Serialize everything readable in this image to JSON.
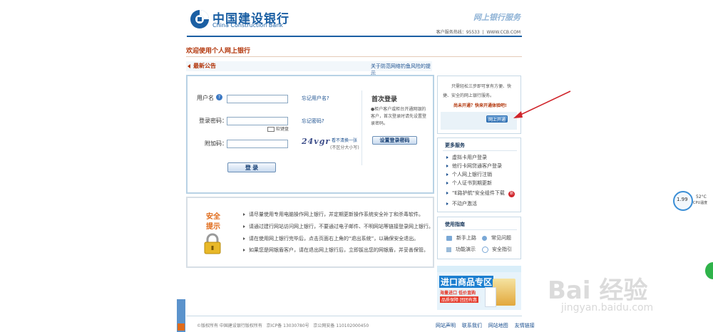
{
  "header": {
    "logo_cn": "中国建设银行",
    "logo_en": "China Construction Bank",
    "service_title": "网上银行服务",
    "hotline": "客户服务热线：95533",
    "url": "WWW.CCB.COM"
  },
  "welcome": "欢迎使用个人网上银行",
  "notice": {
    "label": "最新公告",
    "link": "关于防范网络钓鱼风险的提示"
  },
  "login": {
    "username_label": "用户名",
    "forgot_username": "忘记用户名?",
    "password_label": "登录密码：",
    "forgot_password": "忘记密码?",
    "soft_keyboard": "软键盘",
    "captcha_label": "附加码：",
    "captcha_text": "24vgr",
    "captcha_refresh": "看不清换一张",
    "captcha_hint": "(不区分大小写)",
    "submit": "登 录"
  },
  "first_login": {
    "title": "首次登录",
    "desc": "●柜户客户或柜台开通网银的客户，首次登录时请先设置登录密码。",
    "button": "设置登录密码"
  },
  "promo": {
    "text": "只需轻松三步即可享有方便、快捷、安全的网上银行服务。",
    "question": "尚未开通？快来开通体验吧!",
    "button": "网上开通"
  },
  "more_services": {
    "title": "更多服务",
    "items": [
      "虚拟卡用户登录",
      "他行卡网贷通客户登录",
      "个人网上银行注销",
      "个人证书到期更新",
      "\"E路护航\"安全组件下载",
      "不动户激活"
    ],
    "badge": "新"
  },
  "guide": {
    "title": "使用指南",
    "items": [
      "新手上路",
      "常见问题",
      "功能演示",
      "安全指引"
    ]
  },
  "security": {
    "title_line1": "安全",
    "title_line2": "提示",
    "tips": [
      "请尽量使用专用电脑操作网上银行，并定期更新操作系统安全补丁和杀毒软件。",
      "请通过建行网站访问网上银行，不要通过电子邮件、不明网站等链接登录网上银行。",
      "请在使用网上银行完毕后，点击页面右上角的“退出系统”，以确保安全退出。",
      "如果您是网银盾客户，请在退出网上银行后，立即拔出您的网银盾，并妥善保管。"
    ]
  },
  "banner": {
    "top": "进口商品专区",
    "line2": "海量进口 低价直购",
    "line3": "品质保障 团团有惠"
  },
  "footer": {
    "copyright": "©版权所有 中国建设银行版权所有",
    "icp": "京ICP备 13030780号",
    "police": "京公网安备 110102000450",
    "links": [
      "网站声明",
      "联系我们",
      "网站地图",
      "友情链接"
    ]
  },
  "side_widget": {
    "percent": "1.99",
    "temp": "52°C",
    "cpu": "CPU温度"
  },
  "watermark": {
    "brand": "Bai 经验",
    "url": "jingyan.baidu.com"
  },
  "colors": {
    "brand_blue": "#1b5fa3",
    "welcome_red": "#b3370c",
    "orange": "#e06b1a",
    "arrow_red": "#d0252b"
  }
}
